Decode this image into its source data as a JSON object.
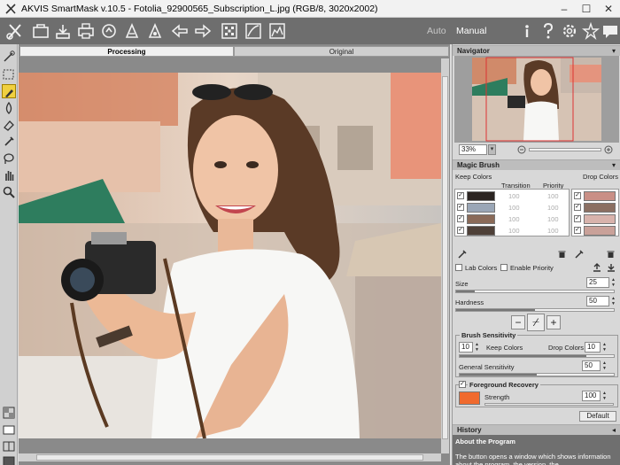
{
  "window": {
    "title": "AKVIS SmartMask v.10.5 - Fotolia_92900565_Subscription_L.jpg (RGB/8, 3020x2002)",
    "minimize": "–",
    "maximize": "☐",
    "close": "✕"
  },
  "toolbar": {
    "mode_auto": "Auto",
    "mode_manual": "Manual",
    "buttons": [
      "open-icon",
      "save-icon",
      "print-icon",
      "share-icon",
      "brush-pre-icon",
      "brush-post-icon",
      "undo-icon",
      "redo-icon",
      "run-icon",
      "curve-icon",
      "histogram-icon",
      "info-icon",
      "help-icon",
      "settings-icon",
      "tips-icon",
      "chat-icon"
    ]
  },
  "tabs": {
    "processing": "Processing",
    "original": "Original"
  },
  "navigator": {
    "title": "Navigator",
    "zoom": "33%",
    "zoom_options": [
      "33%"
    ]
  },
  "magic_brush": {
    "title": "Magic Brush",
    "keep_colors": "Keep Colors",
    "drop_colors": "Drop Colors",
    "transition": "Transition",
    "priority": "Priority",
    "rows": [
      {
        "color": "#2b2421",
        "transition": "100",
        "priority": "100",
        "checked": "✓"
      },
      {
        "color": "#9aa6b6",
        "transition": "100",
        "priority": "100",
        "checked": "✓"
      },
      {
        "color": "#8a6a58",
        "transition": "100",
        "priority": "100",
        "checked": "✓"
      },
      {
        "color": "#4e4038",
        "transition": "100",
        "priority": "100",
        "checked": "✓"
      }
    ],
    "drop_rows": [
      {
        "color": "#c98f86",
        "checked": "✓"
      },
      {
        "color": "#8b6f62",
        "checked": "✓"
      },
      {
        "color": "#d8b3ac",
        "checked": "✓"
      },
      {
        "color": "#c9a199",
        "checked": "✓"
      }
    ],
    "lab_colors": "Lab Colors",
    "enable_priority": "Enable Priority",
    "size_label": "Size",
    "size_value": "25",
    "hardness_label": "Hardness",
    "hardness_value": "50",
    "size_fraction": 0.12,
    "hardness_fraction": 0.5
  },
  "brush_sensitivity": {
    "title": "Brush Sensitivity",
    "keep_value": "10",
    "keep_label": "Keep Colors",
    "drop_label": "Drop Colors",
    "drop_value": "10",
    "general_label": "General Sensitivity",
    "general_value": "50"
  },
  "foreground_recovery": {
    "title": "Foreground Recovery",
    "checked": "✓",
    "color": "#f06a2e",
    "strength_label": "Strength",
    "strength_value": "100"
  },
  "default_button": "Default",
  "history": {
    "title": "History",
    "about_title": "About the Program",
    "about_text": "The button opens a window which shows information about the program, the version, the"
  }
}
